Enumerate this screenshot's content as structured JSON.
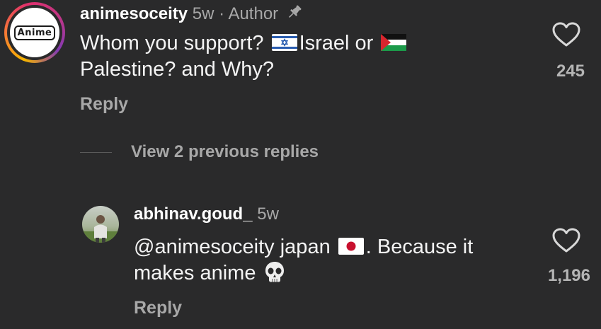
{
  "comment": {
    "username": "animesoceity",
    "time": "5w",
    "separator": "·",
    "author_label": "Author",
    "avatar_logo_text": "Anime",
    "text_part1": "Whom you support?",
    "text_part2": "Israel or",
    "text_part3": "Palestine? and Why?",
    "flag1_icon": "israel-flag-icon",
    "flag2_icon": "palestine-flag-icon",
    "likes": "245",
    "reply_label": "Reply"
  },
  "view_replies": {
    "label": "View 2 previous replies"
  },
  "reply": {
    "username": "abhinav.goud_",
    "time": "5w",
    "text_part1": "@animesoceity japan",
    "text_part2": ". Because it",
    "text_part3": "makes anime",
    "flag_icon": "japan-flag-icon",
    "emoji_icon": "skull-icon",
    "likes": "1,196",
    "reply_label": "Reply"
  },
  "colors": {
    "background": "#2a2a2b",
    "text": "#f4f4f4",
    "muted": "#a8a8a8"
  }
}
